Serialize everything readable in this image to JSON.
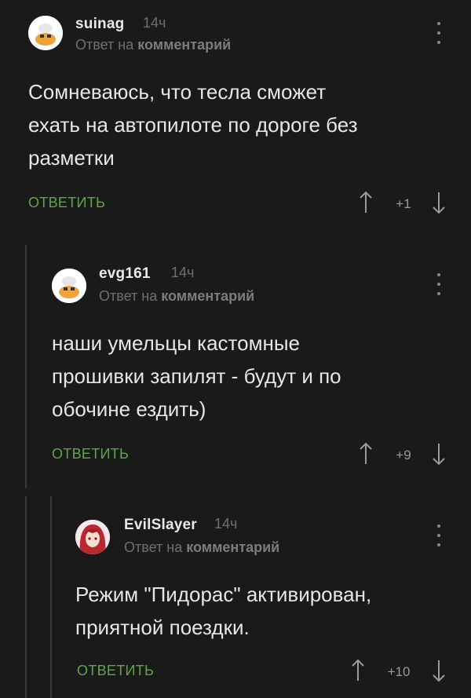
{
  "comments": [
    {
      "username": "suinag",
      "time": "14ч",
      "reply_prefix": "Ответ на",
      "reply_target": "комментарий",
      "text_lines": [
        "Сомневаюсь, что тесла сможет",
        "ехать на автопилоте по дороге без",
        "разметки"
      ],
      "reply_label": "ОТВЕТИТЬ",
      "score": "+1",
      "avatar": "cat-avatar-icon"
    },
    {
      "username": "evg161",
      "time": "14ч",
      "reply_prefix": "Ответ на",
      "reply_target": "комментарий",
      "text_lines": [
        "наши умельцы кастомные",
        "прошивки запилят - будут и по",
        "обочине ездить)"
      ],
      "reply_label": "ОТВЕТИТЬ",
      "score": "+9",
      "avatar": "cat-avatar-icon"
    },
    {
      "username": "EvilSlayer",
      "time": "14ч",
      "reply_prefix": "Ответ на",
      "reply_target": "комментарий",
      "text_lines": [
        "Режим \"Пидорас\" активирован,",
        "приятной поездки."
      ],
      "reply_label": "ОТВЕТИТЬ",
      "score": "+10",
      "avatar": "anime-girl-avatar-icon"
    }
  ],
  "colors": {
    "background": "#1a1a1a",
    "reply_green": "#5fa64a",
    "thread_line": "#3a3a3a"
  }
}
